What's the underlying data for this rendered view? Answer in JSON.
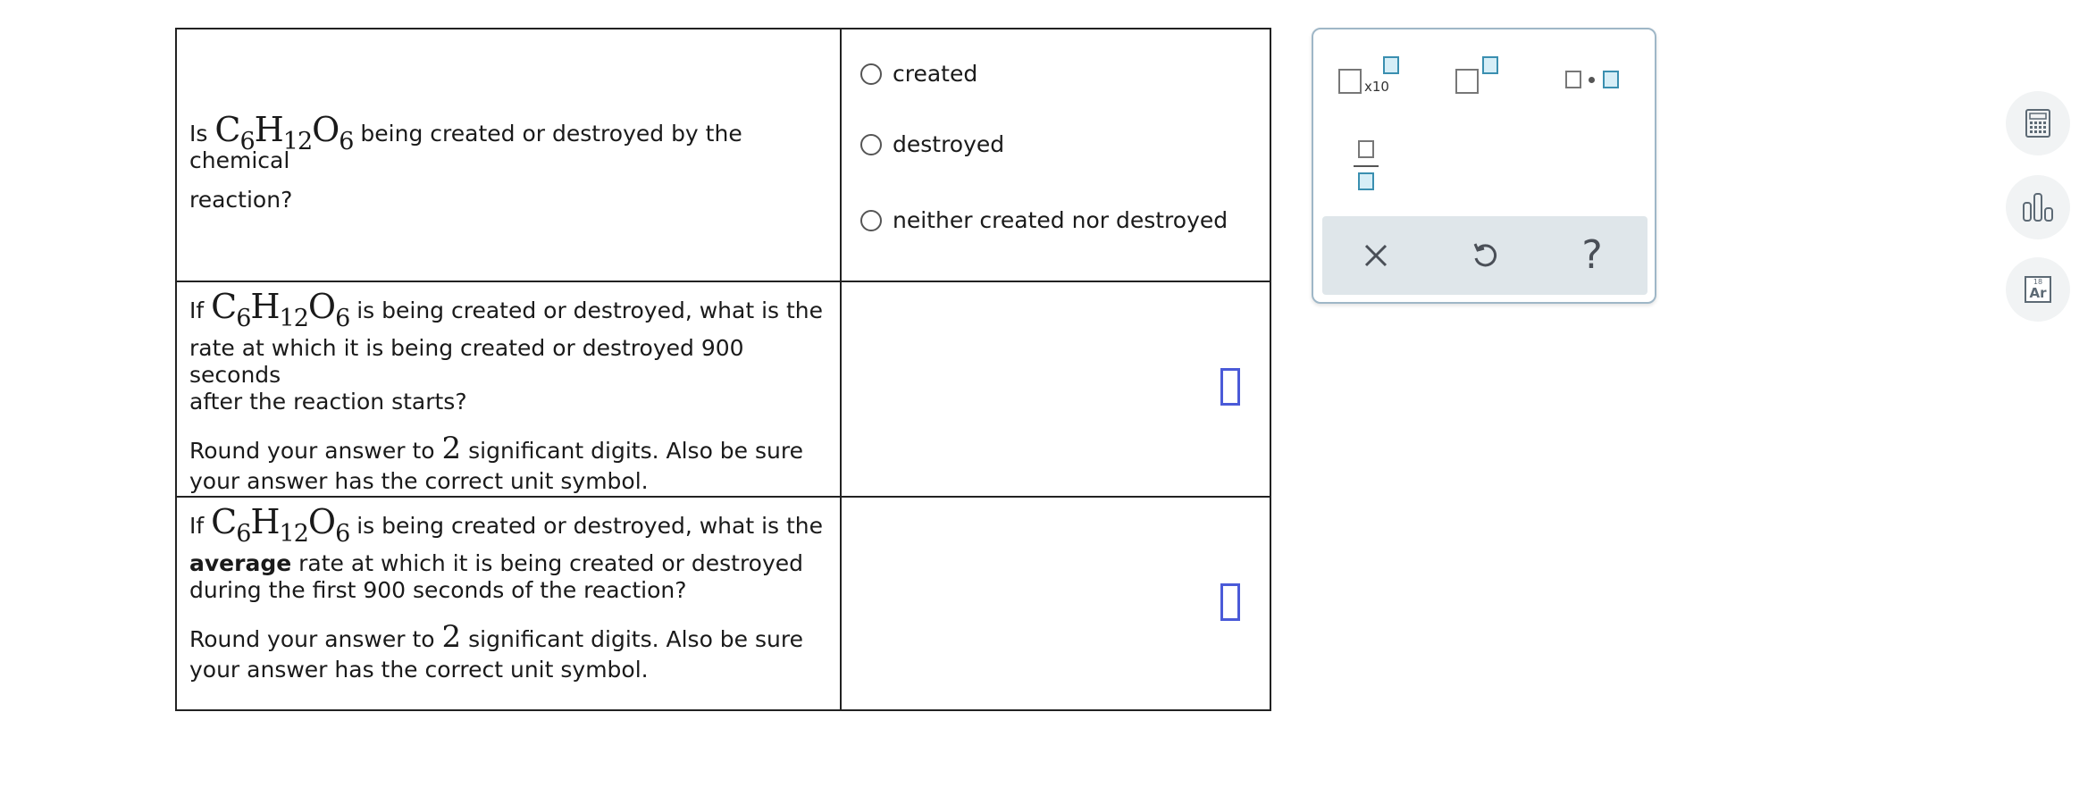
{
  "questions": [
    {
      "prefix": "Is",
      "formula": {
        "c": "C",
        "c_sub": "6",
        "h": "H",
        "h_sub": "12",
        "o": "O",
        "o_sub": "6"
      },
      "line1_rest": "being created or destroyed by the chemical",
      "line2": "reaction?",
      "options": [
        "created",
        "destroyed",
        "neither created nor destroyed"
      ]
    },
    {
      "prefix": "If",
      "formula": {
        "c": "C",
        "c_sub": "6",
        "h": "H",
        "h_sub": "12",
        "o": "O",
        "o_sub": "6"
      },
      "line1_rest": "is being created or destroyed, what is the",
      "line2": "rate at which it is being created or destroyed 900 seconds",
      "line3": "after the reaction starts?",
      "round_pre": "Round your answer to",
      "round_num": "2",
      "round_post": "significant digits. Also be sure",
      "round_line2": "your answer has the correct unit symbol."
    },
    {
      "prefix": "If",
      "formula": {
        "c": "C",
        "c_sub": "6",
        "h": "H",
        "h_sub": "12",
        "o": "O",
        "o_sub": "6"
      },
      "line1_rest": "is being created or destroyed, what is the",
      "line2_bold": "average",
      "line2_rest": "rate at which it is being created or destroyed",
      "line3": "during the first 900 seconds of the reaction?",
      "round_pre": "Round your answer to",
      "round_num": "2",
      "round_post": "significant digits. Also be sure",
      "round_line2": "your answer has the correct unit symbol."
    }
  ],
  "palette": {
    "x10_label": "x10",
    "help_label": "?"
  },
  "sidebar": {
    "periodic_number": "18",
    "periodic_symbol": "Ar"
  },
  "colors": {
    "input_border": "#4a5ad8",
    "palette_blue": "#3a8fb0",
    "palette_actions_bg": "#dfe6ea"
  }
}
